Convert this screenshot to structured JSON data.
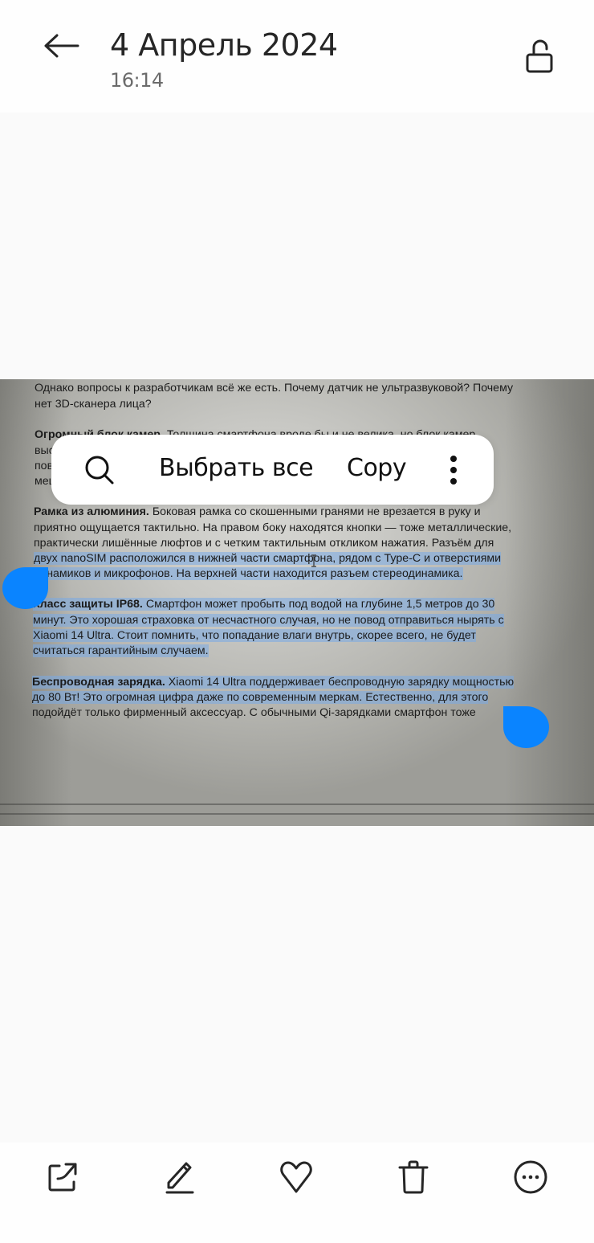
{
  "header": {
    "back_icon": "arrow-left-icon",
    "title": "4 Апрель 2024",
    "time": "16:14",
    "lock_icon": "unlock-icon"
  },
  "document": {
    "paragraphs": [
      {
        "lines": [
          {
            "text": "Однако вопросы к разработчикам всё же есть. Почему датчик не ультразвуковой? Почему",
            "selected": false
          },
          {
            "text": "нет 3D-сканера лица?",
            "selected": false
          }
        ]
      },
      {
        "lines": [
          {
            "bold": "Огромный блок камер.",
            "text": " Толщина смартфона вроде бы и не велика, но блок камер",
            "selected": false
          },
          {
            "text": "выс…",
            "selected": false
          },
          {
            "text": "пов…",
            "selected": false
          },
          {
            "text": "мец…",
            "selected": false
          }
        ]
      },
      {
        "lines": [
          {
            "bold": "Рамка из алюминия.",
            "text": " Боковая рамка со скошенными гранями не врезается в руку и",
            "selected": false
          },
          {
            "text": "приятно ощущается тактильно. На правом боку находятся кнопки — тоже металлические,",
            "selected": false
          },
          {
            "text": "практически лишённые люфтов и с четким тактильным откликом нажатия. Разъём для",
            "selected": false
          },
          {
            "text": "двух nanoSIM расположился в нижней части смартфона, рядом с Type-C и отверстиями",
            "selected": true
          },
          {
            "text": "динамиков и микрофонов. На верхней части находится разъем стереодинамика.",
            "selected": true
          }
        ]
      },
      {
        "lines": [
          {
            "bold": "Класс защиты IP68.",
            "text": " Смартфон может пробыть под водой на глубине 1,5 метров до 30",
            "selected": true
          },
          {
            "text": "минут. Это хорошая страховка от несчастного случая, но не повод отправиться нырять с",
            "selected": true
          },
          {
            "text": "Xiaomi 14 Ultra. Стоит помнить, что попадание влаги внутрь, скорее всего, не будет",
            "selected": true
          },
          {
            "text": "считаться гарантийным случаем.",
            "selected": true
          }
        ]
      },
      {
        "lines": [
          {
            "bold": "Беспроводная зарядка.",
            "text": " Xiaomi 14 Ultra поддерживает беспроводную зарядку мощностью",
            "selected": true
          },
          {
            "text": "до 80 Вт! Это огромная цифра даже по современным меркам. Естественно, для этого",
            "selected": true
          },
          {
            "text": "подойдёт только фирменный аксессуар. С обычными Qi-зарядками смартфон тоже",
            "selected": false
          }
        ]
      }
    ]
  },
  "selection_popup": {
    "search_icon": "search-icon",
    "select_all_label": "Выбрать все",
    "copy_label": "Copy",
    "more_icon": "more-vertical-icon"
  },
  "toolbar": {
    "items": [
      {
        "name": "share",
        "icon": "share-icon"
      },
      {
        "name": "edit",
        "icon": "edit-icon"
      },
      {
        "name": "favorite",
        "icon": "heart-icon"
      },
      {
        "name": "delete",
        "icon": "trash-icon"
      },
      {
        "name": "more",
        "icon": "more-circle-icon"
      }
    ]
  },
  "colors": {
    "accent": "#0a84ff",
    "selection": "#8fb6e0",
    "text_primary": "#262626",
    "text_secondary": "#6b6b6b"
  }
}
